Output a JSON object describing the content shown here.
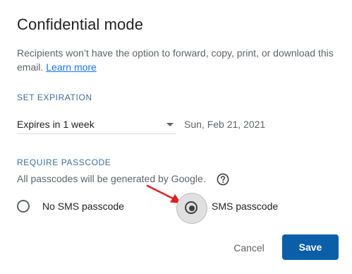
{
  "dialog": {
    "title": "Confidential mode",
    "description": "Recipients won’t have the option to forward, copy, print, or download this email.",
    "learn_more": "Learn more"
  },
  "expiration": {
    "section_label": "SET EXPIRATION",
    "selected": "Expires in 1 week",
    "date": "Sun, Feb 21, 2021"
  },
  "passcode": {
    "section_label": "REQUIRE PASSCODE",
    "note": "All passcodes will be generated by Google.",
    "options": [
      {
        "label": "No SMS passcode",
        "selected": false
      },
      {
        "label": "SMS passcode",
        "selected": true
      }
    ]
  },
  "actions": {
    "cancel": "Cancel",
    "save": "Save"
  },
  "colors": {
    "accent": "#0b5ea8",
    "link": "#1a73e8",
    "annotation_arrow": "#e02020"
  },
  "icons": {
    "help": "help-circle-icon",
    "dropdown": "caret-down-icon",
    "annotation": "red-arrow-icon"
  }
}
